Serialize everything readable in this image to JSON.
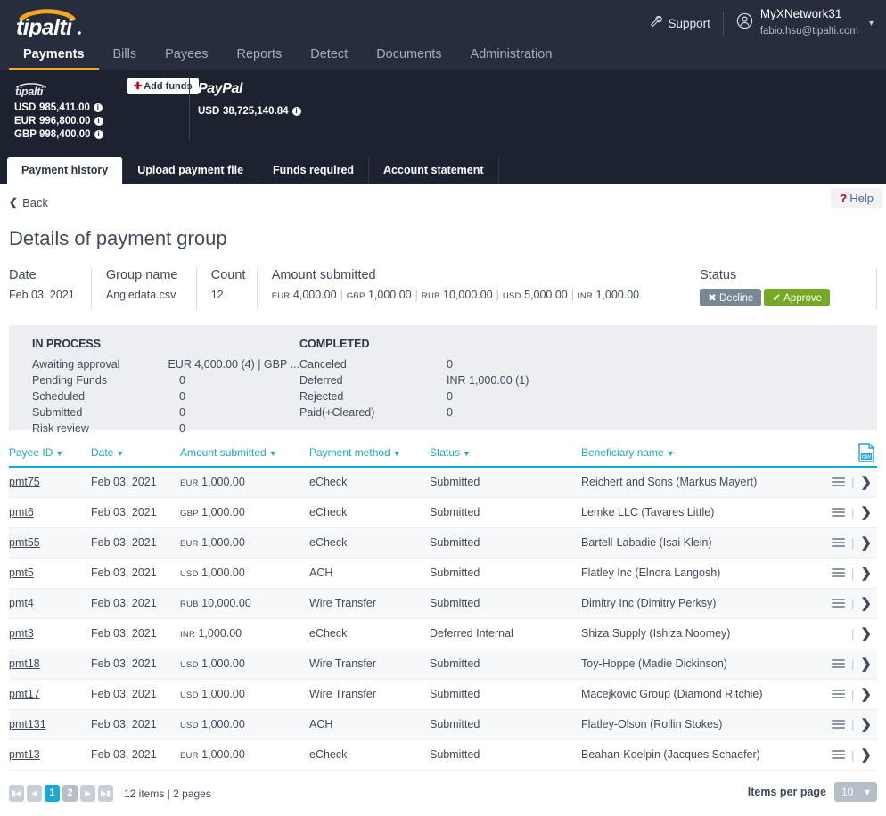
{
  "brand": {
    "name": "tipalti",
    "accent": "#f5a623",
    "link": "#1ba9d4"
  },
  "topnav": {
    "items": [
      {
        "label": "Payments",
        "active": true
      },
      {
        "label": "Bills",
        "active": false
      },
      {
        "label": "Payees",
        "active": false
      },
      {
        "label": "Reports",
        "active": false
      },
      {
        "label": "Detect",
        "active": false
      },
      {
        "label": "Documents",
        "active": false
      },
      {
        "label": "Administration",
        "active": false
      }
    ],
    "support_label": "Support",
    "account_name": "MyXNetwork31",
    "account_email": "fabio.hsu@tipalti.com"
  },
  "balances": {
    "add_funds_label": "Add funds",
    "tipalti": {
      "provider": "tipalti",
      "rows": [
        {
          "currency": "USD",
          "amount": "985,411.00"
        },
        {
          "currency": "EUR",
          "amount": "996,800.00"
        },
        {
          "currency": "GBP",
          "amount": "998,400.00"
        }
      ]
    },
    "paypal": {
      "provider": "PayPal",
      "rows": [
        {
          "currency": "USD",
          "amount": "38,725,140.84"
        }
      ]
    }
  },
  "subtabs": [
    {
      "label": "Payment history",
      "active": true
    },
    {
      "label": "Upload payment file",
      "active": false
    },
    {
      "label": "Funds required",
      "active": false
    },
    {
      "label": "Account statement",
      "active": false
    }
  ],
  "page": {
    "back_label": "Back",
    "help_label": "Help",
    "title": "Details of payment group"
  },
  "summary": {
    "date_label": "Date",
    "date_value": "Feb 03, 2021",
    "group_label": "Group name",
    "group_value": "Angiedata.csv",
    "count_label": "Count",
    "count_value": "12",
    "amount_label": "Amount submitted",
    "amount_parts": [
      {
        "currency": "EUR",
        "value": "4,000.00"
      },
      {
        "currency": "GBP",
        "value": "1,000.00"
      },
      {
        "currency": "RUB",
        "value": "10,000.00"
      },
      {
        "currency": "USD",
        "value": "5,000.00"
      },
      {
        "currency": "INR",
        "value": "1,000.00"
      }
    ],
    "status_label": "Status",
    "decline_label": "Decline",
    "approve_label": "Approve"
  },
  "status_panel": {
    "in_process_title": "IN PROCESS",
    "in_process": [
      {
        "key": "Awaiting approval",
        "value": "EUR 4,000.00 (4)  |  GBP ..."
      },
      {
        "key": "Pending Funds",
        "value": "0"
      },
      {
        "key": "Scheduled",
        "value": "0"
      },
      {
        "key": "Submitted",
        "value": "0"
      },
      {
        "key": "Risk review",
        "value": "0"
      }
    ],
    "completed_title": "COMPLETED",
    "completed": [
      {
        "key": "Canceled",
        "value": "0"
      },
      {
        "key": "Deferred",
        "value": "INR 1,000.00 (1)"
      },
      {
        "key": "Rejected",
        "value": "0"
      },
      {
        "key": "Paid(+Cleared)",
        "value": "0"
      }
    ]
  },
  "table": {
    "columns": [
      "Payee ID",
      "Date",
      "Amount submitted",
      "Payment method",
      "Status",
      "Beneficiary name"
    ],
    "export_icon": "csv-export-icon",
    "rows": [
      {
        "payee_id": "pmt75",
        "date": "Feb 03, 2021",
        "currency": "EUR",
        "amount": "1,000.00",
        "method": "eCheck",
        "status": "Submitted",
        "beneficiary": "Reichert and Sons (Markus Mayert)",
        "has_menu": true
      },
      {
        "payee_id": "pmt6",
        "date": "Feb 03, 2021",
        "currency": "GBP",
        "amount": "1,000.00",
        "method": "eCheck",
        "status": "Submitted",
        "beneficiary": "Lemke LLC (Tavares Little)",
        "has_menu": true
      },
      {
        "payee_id": "pmt55",
        "date": "Feb 03, 2021",
        "currency": "EUR",
        "amount": "1,000.00",
        "method": "eCheck",
        "status": "Submitted",
        "beneficiary": "Bartell-Labadie (Isai Klein)",
        "has_menu": true
      },
      {
        "payee_id": "pmt5",
        "date": "Feb 03, 2021",
        "currency": "USD",
        "amount": "1,000.00",
        "method": "ACH",
        "status": "Submitted",
        "beneficiary": "Flatley Inc (Elnora Langosh)",
        "has_menu": true
      },
      {
        "payee_id": "pmt4",
        "date": "Feb 03, 2021",
        "currency": "RUB",
        "amount": "10,000.00",
        "method": "Wire Transfer",
        "status": "Submitted",
        "beneficiary": "Dimitry Inc (Dimitry Perksy)",
        "has_menu": true
      },
      {
        "payee_id": "pmt3",
        "date": "Feb 03, 2021",
        "currency": "INR",
        "amount": "1,000.00",
        "method": "eCheck",
        "status": "Deferred Internal",
        "beneficiary": "Shiza Supply (Ishiza Noomey)",
        "has_menu": false
      },
      {
        "payee_id": "pmt18",
        "date": "Feb 03, 2021",
        "currency": "USD",
        "amount": "1,000.00",
        "method": "Wire Transfer",
        "status": "Submitted",
        "beneficiary": "Toy-Hoppe (Madie Dickinson)",
        "has_menu": true
      },
      {
        "payee_id": "pmt17",
        "date": "Feb 03, 2021",
        "currency": "USD",
        "amount": "1,000.00",
        "method": "Wire Transfer",
        "status": "Submitted",
        "beneficiary": "Macejkovic Group (Diamond Ritchie)",
        "has_menu": true
      },
      {
        "payee_id": "pmt131",
        "date": "Feb 03, 2021",
        "currency": "USD",
        "amount": "1,000.00",
        "method": "ACH",
        "status": "Submitted",
        "beneficiary": "Flatley-Olson (Rollin Stokes)",
        "has_menu": true
      },
      {
        "payee_id": "pmt13",
        "date": "Feb 03, 2021",
        "currency": "EUR",
        "amount": "1,000.00",
        "method": "eCheck",
        "status": "Submitted",
        "beneficiary": "Beahan-Koelpin (Jacques Schaefer)",
        "has_menu": true
      }
    ]
  },
  "footer": {
    "pages": [
      "1",
      "2"
    ],
    "current_page": "1",
    "info": "12 items | 2 pages",
    "items_per_page_label": "Items per page",
    "items_per_page_value": "10"
  }
}
